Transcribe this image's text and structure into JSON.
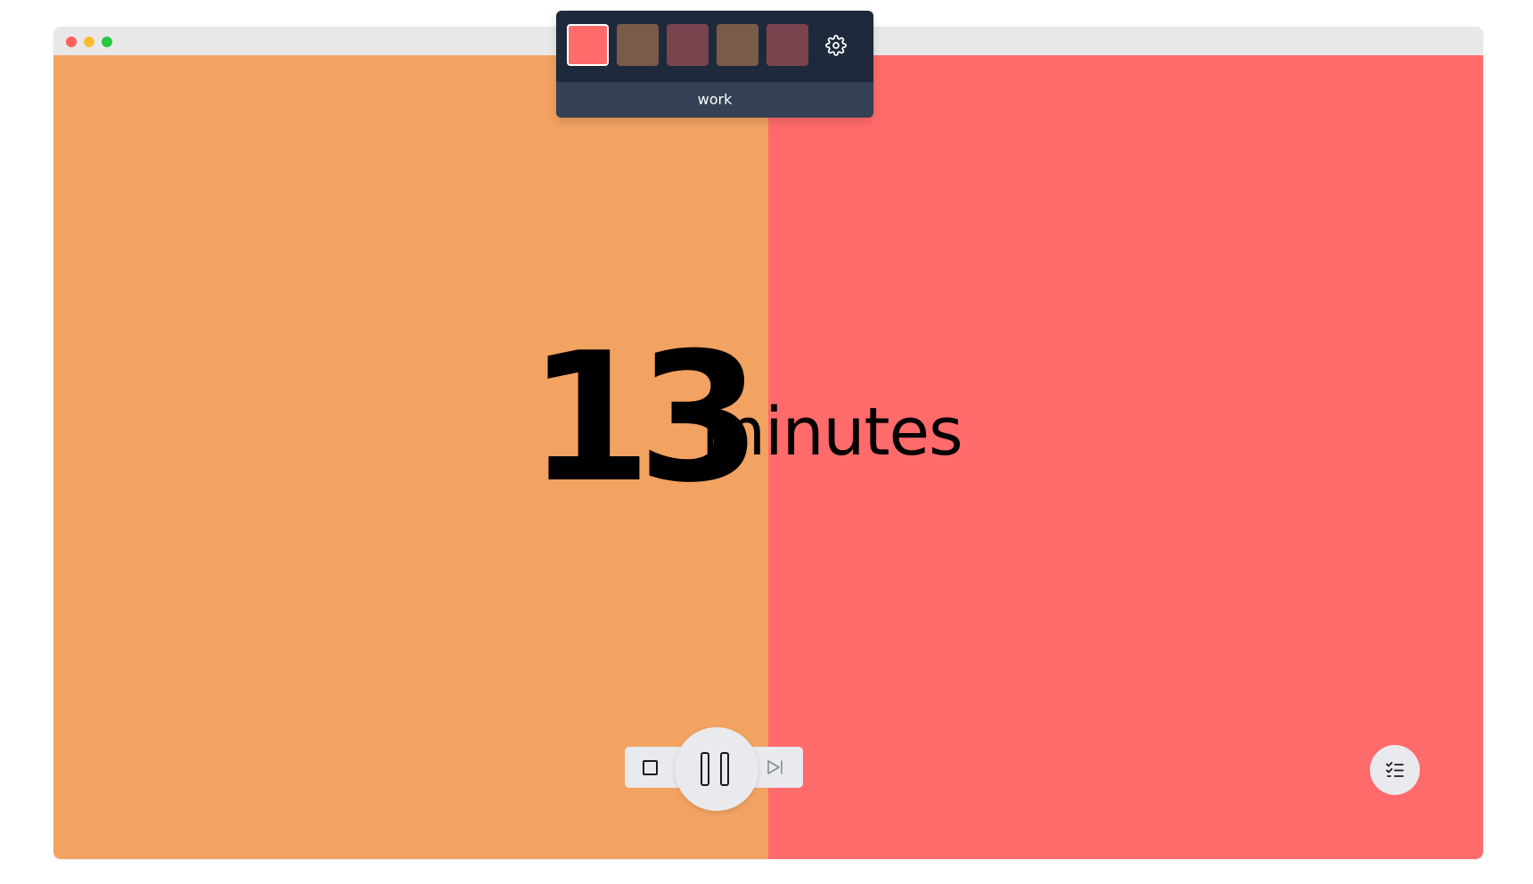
{
  "window": {
    "traffic_lights": {
      "close_color": "#ff5f57",
      "minimize_color": "#febc2e",
      "maximize_color": "#28c840"
    }
  },
  "background": {
    "left_color": "#f2a261",
    "right_color": "#ff6b6b"
  },
  "session_panel": {
    "swatches": [
      {
        "color": "#ff6b6b",
        "selected": true
      },
      {
        "color": "#7a5a48"
      },
      {
        "color": "#7a444f"
      },
      {
        "color": "#7a5a48"
      },
      {
        "color": "#7a444f"
      }
    ],
    "settings_icon": "gear-icon",
    "session_label": "work"
  },
  "timer": {
    "value": "13",
    "unit": "minutes"
  },
  "controls": {
    "stop_icon": "stop-icon",
    "pause_icon": "pause-icon",
    "skip_icon": "skip-forward-icon",
    "tasks_icon": "checklist-icon"
  }
}
